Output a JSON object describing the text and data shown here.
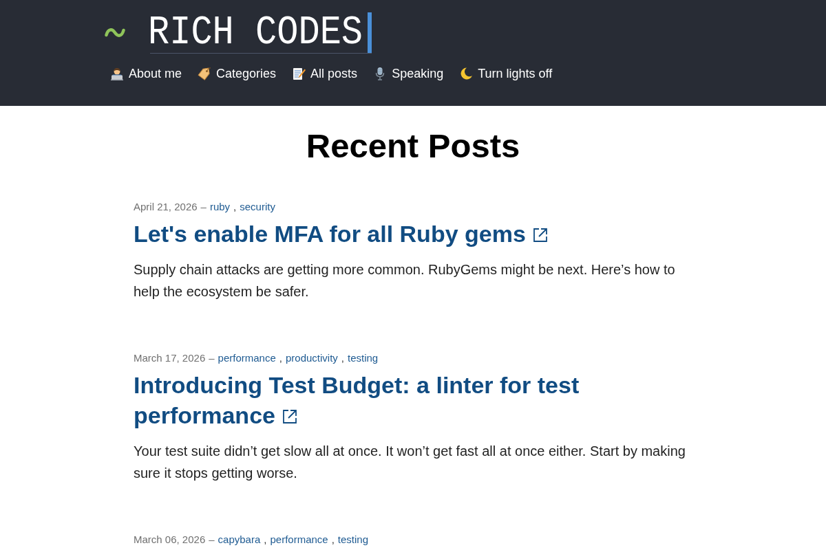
{
  "header": {
    "site_title": "RICH CODES",
    "nav": [
      {
        "kind": "profile",
        "label": "About me"
      },
      {
        "kind": "categories",
        "label": "Categories"
      },
      {
        "kind": "posts",
        "label": "All posts"
      },
      {
        "kind": "speaking",
        "label": "Speaking"
      },
      {
        "kind": "theme",
        "label": "Turn lights off"
      }
    ]
  },
  "main": {
    "heading": "Recent Posts",
    "posts": [
      {
        "date": "April 21, 2026",
        "separator": "–",
        "tags": [
          {
            "label": "ruby",
            "separator": ","
          },
          {
            "label": "security"
          }
        ],
        "title": "Let's enable MFA for all Ruby gems",
        "external": true,
        "excerpt": "Supply chain attacks are getting more common. RubyGems might be next. Here’s how to help the ecosystem be safer."
      },
      {
        "date": "March 17, 2026",
        "separator": "–",
        "tags": [
          {
            "label": "performance",
            "separator": ","
          },
          {
            "label": "productivity",
            "separator": ","
          },
          {
            "label": "testing"
          }
        ],
        "title": "Introducing Test Budget: a linter for test performance",
        "external": true,
        "excerpt": "Your test suite didn’t get slow all at once. It won’t get fast all at once either. Start by making sure it stops getting worse."
      },
      {
        "date": "March 06, 2026",
        "separator": "–",
        "tags": [
          {
            "label": "capybara",
            "separator": ","
          },
          {
            "label": "performance",
            "separator": ","
          },
          {
            "label": "testing"
          }
        ]
      }
    ]
  }
}
